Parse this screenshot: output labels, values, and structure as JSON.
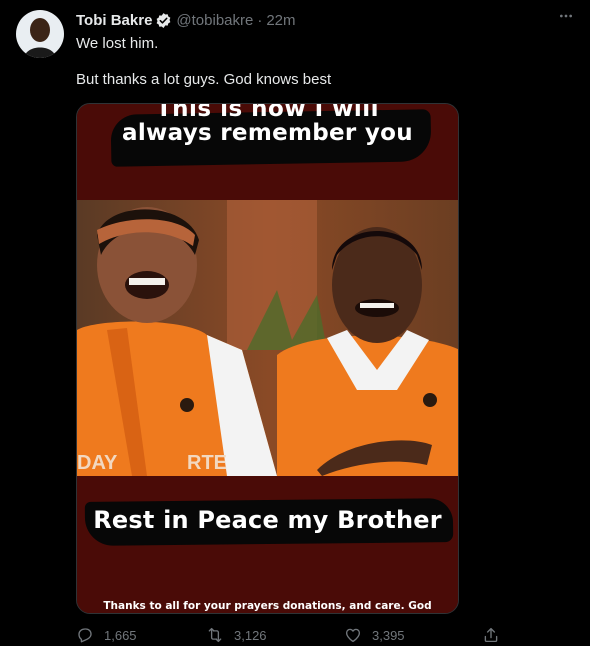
{
  "tweet": {
    "author": {
      "name": "Tobi Bakre",
      "handle": "@tobibakre",
      "separator": "·",
      "time": "22m"
    },
    "text_line1": "We lost him.",
    "text_line2": "But thanks a lot guys. God knows best",
    "media": {
      "caption_top_partial": "This is how I will",
      "caption_top": "always remember you",
      "caption_bottom": "Rest in Peace my Brother",
      "caption_footer": "Thanks to all for your prayers donations, and care. God",
      "shirt_text_left": "DAY",
      "shirt_text_mid": "RTE"
    },
    "stats": {
      "replies": "1,665",
      "retweets": "3,126",
      "likes": "3,395"
    }
  },
  "colors": {
    "background": "#000000",
    "text_primary": "#e7e9ea",
    "text_secondary": "#71767b",
    "verified_blue": "#1d9bf0",
    "banner_red": "#4a0b07",
    "shirt_orange": "#ef7a1e"
  },
  "icons": [
    "verified-icon",
    "more-icon",
    "reply-icon",
    "retweet-icon",
    "like-icon",
    "share-icon"
  ]
}
